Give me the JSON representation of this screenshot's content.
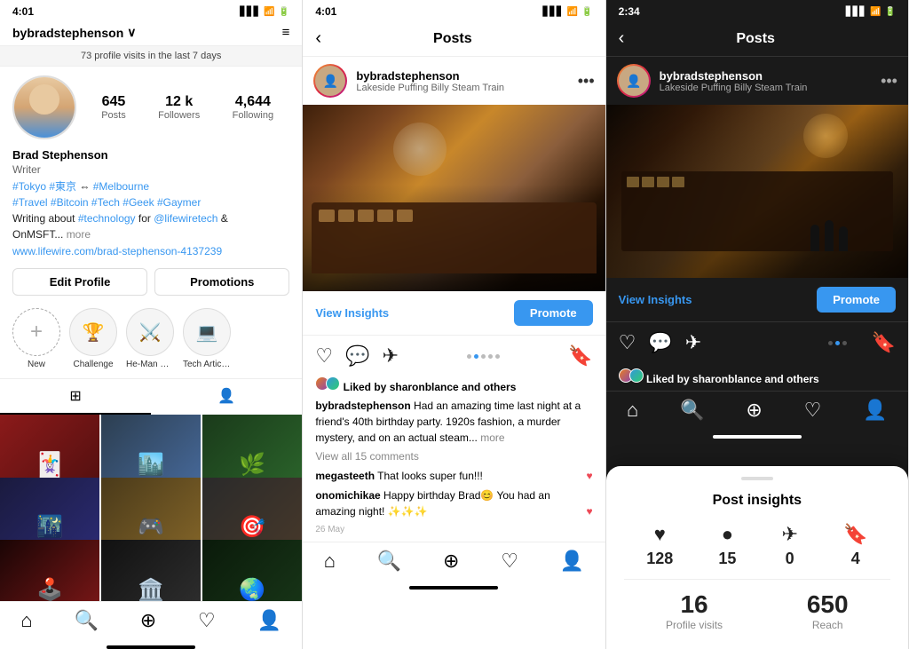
{
  "panel1": {
    "status": {
      "time": "4:01",
      "arrow": "↑",
      "signal": "▋▋▋",
      "wifi": "WiFi",
      "battery": "🔋"
    },
    "username": "bybradstephenson",
    "username_arrow": "∨",
    "menu_icon": "≡",
    "visits_bar": "73 profile visits in the last 7 days",
    "stats": {
      "posts": {
        "num": "645",
        "label": "Posts"
      },
      "followers": {
        "num": "12 k",
        "label": "Followers"
      },
      "following": {
        "num": "4,644",
        "label": "Following"
      }
    },
    "name": "Brad Stephenson",
    "title": "Writer",
    "bio_line1": "#Tokyo #東京 ⇔ #Melbourne",
    "bio_line2": "#Travel #Bitcoin #Tech #Geek #Gaymer",
    "bio_line3": "Writing about #technology for @lifewiretech &",
    "bio_line4": "OnMSFT...",
    "bio_more": "more",
    "bio_link": "www.lifewire.com/brad-stephenson-4137239",
    "edit_profile_label": "Edit Profile",
    "promotions_label": "Promotions",
    "stories": [
      {
        "label": "New",
        "icon": "+"
      },
      {
        "label": "Challenge",
        "icon": "🏆"
      },
      {
        "label": "He-Man Mo...",
        "icon": "⚔️"
      },
      {
        "label": "Tech Articles",
        "icon": "💻"
      }
    ],
    "nav": {
      "home": "⌂",
      "search": "🔍",
      "add": "⊕",
      "heart": "♡",
      "person": "👤"
    }
  },
  "panel2": {
    "status": {
      "time": "4:01",
      "arrow": "↑"
    },
    "header": {
      "back": "‹",
      "title": "Posts"
    },
    "post": {
      "username": "bybradstephenson",
      "location": "Lakeside Puffing Billy Steam Train",
      "view_insights": "View Insights",
      "promote": "Promote",
      "dots": [
        false,
        true,
        false,
        false,
        false
      ],
      "liked_by_prefix": "Liked by ",
      "liked_by_name": "sharonblance",
      "liked_by_suffix": " and others",
      "caption_user": "bybradstephenson",
      "caption_text": " Had an amazing time last night at a friend's 40th birthday party. 1920s fashion, a murder mystery, and on an actual steam...",
      "caption_more": " more",
      "view_comments": "View all 15 comments",
      "comments": [
        {
          "user": "megasteeth",
          "text": " That looks super fun!!!",
          "heart": true
        },
        {
          "user": "onomichikae",
          "text": " Happy birthday Brad😊 You had an amazing night! ✨✨✨",
          "heart": true
        }
      ],
      "date": "26 May"
    },
    "nav": {
      "home": "⌂",
      "search": "🔍",
      "add": "⊕",
      "heart": "♡",
      "person": "👤"
    }
  },
  "panel3": {
    "status": {
      "time": "2:34",
      "arrow": ""
    },
    "header": {
      "back": "‹",
      "title": "Posts"
    },
    "post": {
      "username": "bybradstephenson",
      "location": "Lakeside Puffing Billy Steam Train",
      "view_insights": "View Insights",
      "promote": "Promote",
      "liked_by_prefix": "Liked by ",
      "liked_by_name": "sharonblance",
      "liked_by_suffix": " and others"
    },
    "insights": {
      "title": "Post insights",
      "likes": "128",
      "comments": "15",
      "shares": "0",
      "saves": "4",
      "profile_visits": "16",
      "profile_visits_label": "Profile visits",
      "reach": "650",
      "reach_label": "Reach"
    },
    "nav": {
      "home": "⌂",
      "search": "🔍",
      "add": "⊕",
      "heart": "♡",
      "person": "👤"
    }
  }
}
